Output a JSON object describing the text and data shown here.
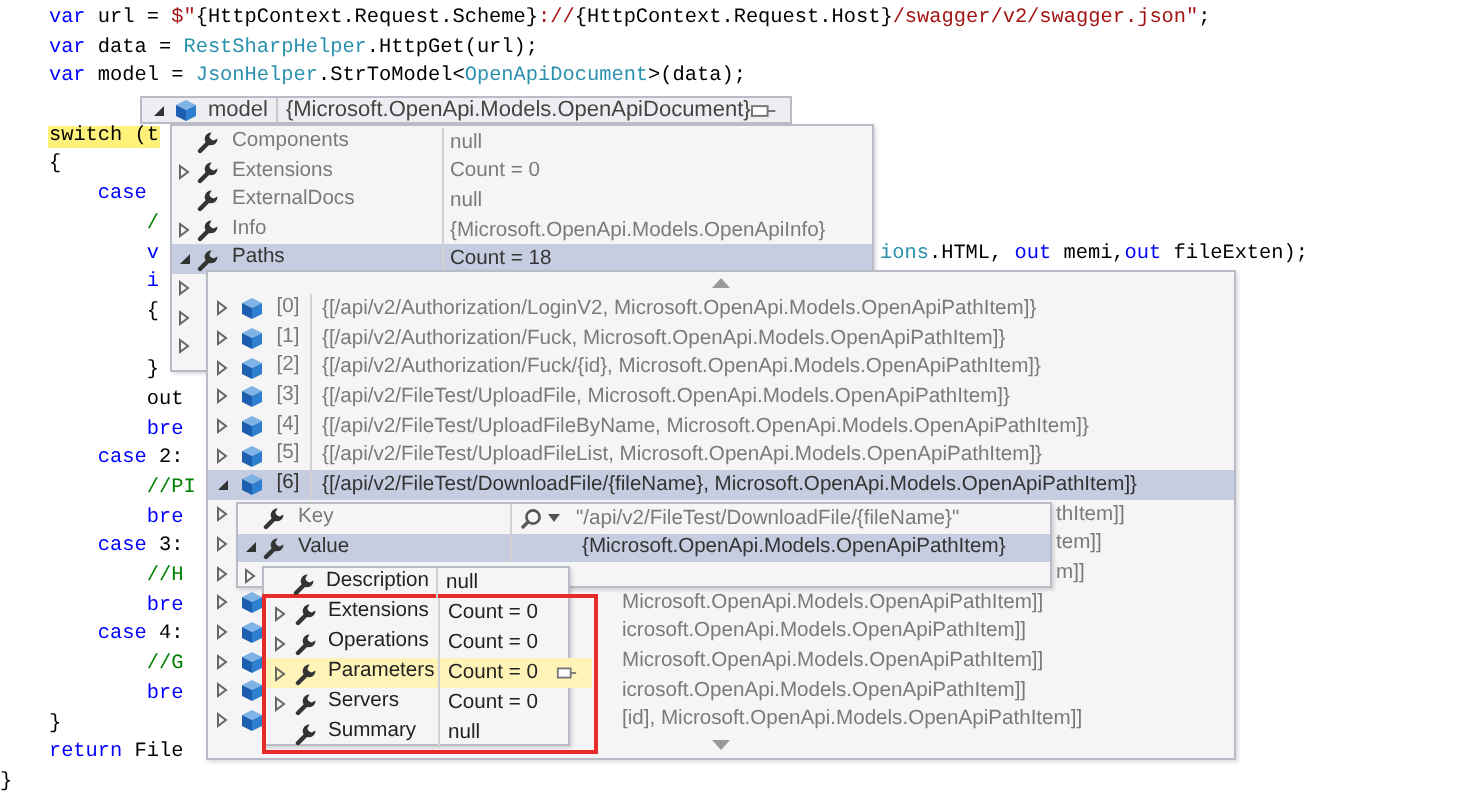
{
  "code": {
    "lines": [
      {
        "tokens": [
          {
            "text": "    var",
            "kind": "keyword"
          },
          {
            "text": " url = ",
            "kind": "plain"
          },
          {
            "text": "$\"",
            "kind": "string"
          },
          {
            "text": "{HttpContext.Request.Scheme}",
            "kind": "plain"
          },
          {
            "text": "://",
            "kind": "string"
          },
          {
            "text": "{HttpContext.Request.Host}",
            "kind": "plain"
          },
          {
            "text": "/swagger/v2/swagger.json\"",
            "kind": "string"
          },
          {
            "text": ";",
            "kind": "plain"
          }
        ]
      },
      {
        "tokens": [
          {
            "text": "    var",
            "kind": "keyword"
          },
          {
            "text": " data = ",
            "kind": "plain"
          },
          {
            "text": "RestSharpHelper",
            "kind": "type"
          },
          {
            "text": ".HttpGet(url);",
            "kind": "plain"
          }
        ]
      },
      {
        "tokens": [
          {
            "text": "    var",
            "kind": "keyword"
          },
          {
            "text": " model = ",
            "kind": "plain"
          },
          {
            "text": "JsonHelper",
            "kind": "type"
          },
          {
            "text": ".StrToModel<",
            "kind": "plain"
          },
          {
            "text": "OpenApiDocument",
            "kind": "type"
          },
          {
            "text": ">(data);",
            "kind": "plain"
          }
        ]
      },
      {
        "tokens": [
          {
            "text": "    switch (t",
            "kind": "current"
          }
        ]
      },
      {
        "tokens": [
          {
            "text": "    {",
            "kind": "plain"
          }
        ]
      },
      {
        "tokens": [
          {
            "text": "        case",
            "kind": "keyword"
          }
        ]
      },
      {
        "tokens": [
          {
            "text": "            /",
            "kind": "comment"
          }
        ]
      },
      {
        "tokens": [
          {
            "text": "            v",
            "kind": "keyword"
          }
        ],
        "tail": [
          {
            "text": "ions",
            "kind": "type"
          },
          {
            "text": ".HTML, ",
            "kind": "plain"
          },
          {
            "text": "out",
            "kind": "keyword"
          },
          {
            "text": " memi,",
            "kind": "plain"
          },
          {
            "text": "out",
            "kind": "keyword"
          },
          {
            "text": " fileExten);",
            "kind": "plain"
          }
        ]
      },
      {
        "tokens": [
          {
            "text": "            i",
            "kind": "keyword"
          }
        ]
      },
      {
        "tokens": [
          {
            "text": "            {",
            "kind": "plain"
          }
        ]
      },
      {
        "tokens": [
          {
            "text": "            }",
            "kind": "plain"
          }
        ]
      },
      {
        "tokens": [
          {
            "text": "            out",
            "kind": "plain"
          }
        ]
      },
      {
        "tokens": [
          {
            "text": "            bre",
            "kind": "keyword"
          }
        ]
      },
      {
        "tokens": [
          {
            "text": "        case",
            "kind": "keyword"
          },
          {
            "text": " 2:",
            "kind": "plain"
          }
        ]
      },
      {
        "tokens": [
          {
            "text": "            //PI",
            "kind": "comment"
          }
        ]
      },
      {
        "tokens": [
          {
            "text": "            bre",
            "kind": "keyword"
          }
        ]
      },
      {
        "tokens": [
          {
            "text": "        case",
            "kind": "keyword"
          },
          {
            "text": " 3:",
            "kind": "plain"
          }
        ]
      },
      {
        "tokens": [
          {
            "text": "            //H",
            "kind": "comment"
          }
        ]
      },
      {
        "tokens": [
          {
            "text": "            bre",
            "kind": "keyword"
          }
        ]
      },
      {
        "tokens": [
          {
            "text": "        case",
            "kind": "keyword"
          },
          {
            "text": " 4:",
            "kind": "plain"
          }
        ]
      },
      {
        "tokens": [
          {
            "text": "            //G",
            "kind": "comment"
          }
        ]
      },
      {
        "tokens": [
          {
            "text": "            bre",
            "kind": "keyword"
          }
        ]
      },
      {
        "tokens": [
          {
            "text": "    }",
            "kind": "plain"
          }
        ]
      },
      {
        "tokens": [
          {
            "text": "    return",
            "kind": "keyword"
          },
          {
            "text": " File",
            "kind": "plain"
          }
        ]
      },
      {
        "tokens": [
          {
            "text": "}",
            "kind": "plain"
          }
        ]
      }
    ]
  },
  "model_tip": {
    "expanded": true,
    "name": "model",
    "value": "{Microsoft.OpenApi.Models.OpenApiDocument}"
  },
  "model_members": [
    {
      "name": "Components",
      "value": "null",
      "selected": false
    },
    {
      "name": "Extensions",
      "value": "Count = 0",
      "expanded": false,
      "selected": false
    },
    {
      "name": "ExternalDocs",
      "value": "null",
      "selected": false
    },
    {
      "name": "Info",
      "value": "{Microsoft.OpenApi.Models.OpenApiInfo}",
      "expanded": false,
      "selected": false
    },
    {
      "name": "Paths",
      "value": "Count = 18",
      "expanded": true,
      "selected": true
    }
  ],
  "paths_items": [
    {
      "index": "[0]",
      "value": "{[/api/v2/Authorization/LoginV2, Microsoft.OpenApi.Models.OpenApiPathItem]}",
      "expanded": false,
      "selected": false
    },
    {
      "index": "[1]",
      "value": "{[/api/v2/Authorization/Fuck, Microsoft.OpenApi.Models.OpenApiPathItem]}",
      "expanded": false,
      "selected": false
    },
    {
      "index": "[2]",
      "value": "{[/api/v2/Authorization/Fuck/{id}, Microsoft.OpenApi.Models.OpenApiPathItem]}",
      "expanded": false,
      "selected": false
    },
    {
      "index": "[3]",
      "value": "{[/api/v2/FileTest/UploadFile, Microsoft.OpenApi.Models.OpenApiPathItem]}",
      "expanded": false,
      "selected": false
    },
    {
      "index": "[4]",
      "value": "{[/api/v2/FileTest/UploadFileByName, Microsoft.OpenApi.Models.OpenApiPathItem]}",
      "expanded": false,
      "selected": false
    },
    {
      "index": "[5]",
      "value": "{[/api/v2/FileTest/UploadFileList, Microsoft.OpenApi.Models.OpenApiPathItem]}",
      "expanded": false,
      "selected": false
    },
    {
      "index": "[6]",
      "value": "{[/api/v2/FileTest/DownloadFile/{fileName}, Microsoft.OpenApi.Models.OpenApiPathItem]}",
      "expanded": true,
      "selected": true
    },
    {
      "value": "thItem]]",
      "expanded": false,
      "selected": false
    },
    {
      "value": "tem]]",
      "expanded": false,
      "selected": false
    },
    {
      "value": "m]]",
      "expanded": false,
      "selected": false
    },
    {
      "value": "Microsoft.OpenApi.Models.OpenApiPathItem]]",
      "expanded": false,
      "selected": false
    },
    {
      "value": "icrosoft.OpenApi.Models.OpenApiPathItem]]",
      "expanded": false,
      "selected": false
    },
    {
      "value": "Microsoft.OpenApi.Models.OpenApiPathItem]]",
      "expanded": false,
      "selected": false
    },
    {
      "value": "icrosoft.OpenApi.Models.OpenApiPathItem]]",
      "expanded": false,
      "selected": false
    },
    {
      "value": "[id], Microsoft.OpenApi.Models.OpenApiPathItem]]",
      "expanded": false,
      "selected": false
    }
  ],
  "path_item_members": [
    {
      "name": "Key",
      "value": "\"/api/v2/FileTest/DownloadFile/{fileName}\"",
      "kind": "visualizer",
      "selected": false
    },
    {
      "name": "Value",
      "value": "{Microsoft.OpenApi.Models.OpenApiPathItem}",
      "kind": "plain",
      "expanded": true,
      "selected": true
    }
  ],
  "value_members": [
    {
      "name": "Description",
      "value": "null",
      "selected": false
    },
    {
      "name": "Extensions",
      "value": "Count = 0",
      "expanded": false,
      "selected": false
    },
    {
      "name": "Operations",
      "value": "Count = 0",
      "expanded": false,
      "selected": false
    },
    {
      "name": "Parameters",
      "value": "Count = 0",
      "expanded": false,
      "selected": true
    },
    {
      "name": "Servers",
      "value": "Count = 0",
      "expanded": false,
      "selected": false
    },
    {
      "name": "Summary",
      "value": "null",
      "selected": false
    }
  ]
}
